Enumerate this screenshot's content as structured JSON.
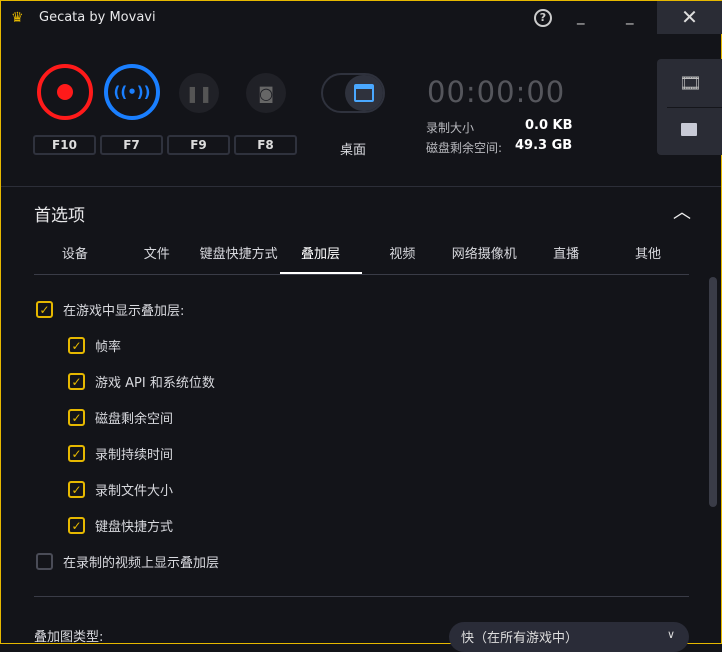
{
  "window": {
    "title": "Gecata by Movavi",
    "help": "?",
    "minimize": "_",
    "maximize": "_",
    "close": "✕"
  },
  "controls": {
    "keys": [
      "F10",
      "F7",
      "F9",
      "F8"
    ],
    "source_label": "桌面"
  },
  "stats": {
    "timer": "00:00:00",
    "rec_size_label": "录制大小",
    "rec_size_value": "0.0 KB",
    "disk_label": "磁盘剩余空间:",
    "disk_value": "49.3 GB"
  },
  "prefs": {
    "title": "首选项",
    "tabs": [
      "设备",
      "文件",
      "键盘快捷方式",
      "叠加层",
      "视频",
      "网络摄像机",
      "直播",
      "其他"
    ],
    "show_overlay": "在游戏中显示叠加层:",
    "items": [
      "帧率",
      "游戏 API 和系统位数",
      "磁盘剩余空间",
      "录制持续时间",
      "录制文件大小",
      "键盘快捷方式"
    ],
    "show_on_video": "在录制的视频上显示叠加层",
    "overlay_type_label": "叠加图类型:",
    "overlay_type_value": "快（在所有游戏中）"
  },
  "colors": {
    "accent": "#e6b800",
    "record": "#ff1a1a",
    "stream": "#1a7fff"
  }
}
